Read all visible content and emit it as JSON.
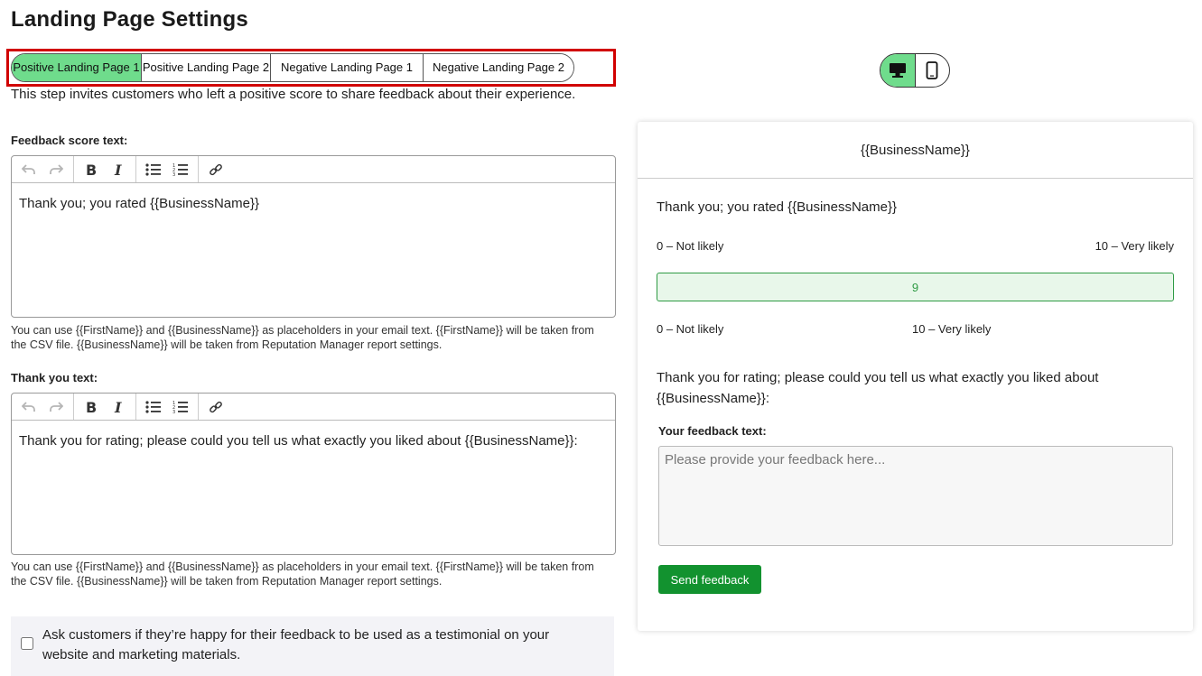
{
  "page": {
    "title": "Landing Page Settings"
  },
  "tabs": [
    {
      "label": "Positive Landing Page 1",
      "active": true
    },
    {
      "label": "Positive Landing Page 2",
      "active": false
    },
    {
      "label": "Negative Landing Page 1",
      "active": false
    },
    {
      "label": "Negative Landing Page 2",
      "active": false
    }
  ],
  "intro": "This step invites customers who left a positive score to share feedback about their experience.",
  "score_field": {
    "label": "Feedback score text:",
    "value": "Thank you; you rated {{BusinessName}}",
    "help": "You can use {{FirstName}} and {{BusinessName}} as placeholders in your email text. {{FirstName}} will be taken from the CSV file. {{BusinessName}} will be taken from Reputation Manager report settings."
  },
  "thanks_field": {
    "label": "Thank you text:",
    "value": "Thank you for rating; please could you tell us what exactly you liked about {{BusinessName}}:",
    "help": "You can use {{FirstName}} and {{BusinessName}} as placeholders in your email text. {{FirstName}} will be taken from the CSV file. {{BusinessName}} will be taken from Reputation Manager report settings."
  },
  "testimonial": {
    "label": "Ask customers if they’re happy for their feedback to be used as a testimonial on your website and marketing materials.",
    "checked": false
  },
  "device_toggle": {
    "active": "desktop"
  },
  "preview": {
    "header": "{{BusinessName}}",
    "rated_text": "Thank you; you rated {{BusinessName}}",
    "scale_low": "0 – Not likely",
    "scale_high": "10 – Very likely",
    "score": "9",
    "scale_low_2": "0 – Not likely",
    "scale_high_2": "10 – Very likely",
    "thanks_text": "Thank you for rating; please could you tell us what exactly you liked about {{BusinessName}}:",
    "feedback_label": "Your feedback text:",
    "feedback_placeholder": "Please provide your feedback here...",
    "send_label": "Send feedback"
  },
  "colors": {
    "active_tab": "#6fdc8c",
    "highlight": "#d10000",
    "score_border": "#2e9a44",
    "send_button": "#12922f"
  },
  "icons": [
    "undo-icon",
    "redo-icon",
    "bold-icon",
    "italic-icon",
    "bullet-list-icon",
    "numbered-list-icon",
    "link-icon",
    "desktop-icon",
    "mobile-icon"
  ]
}
